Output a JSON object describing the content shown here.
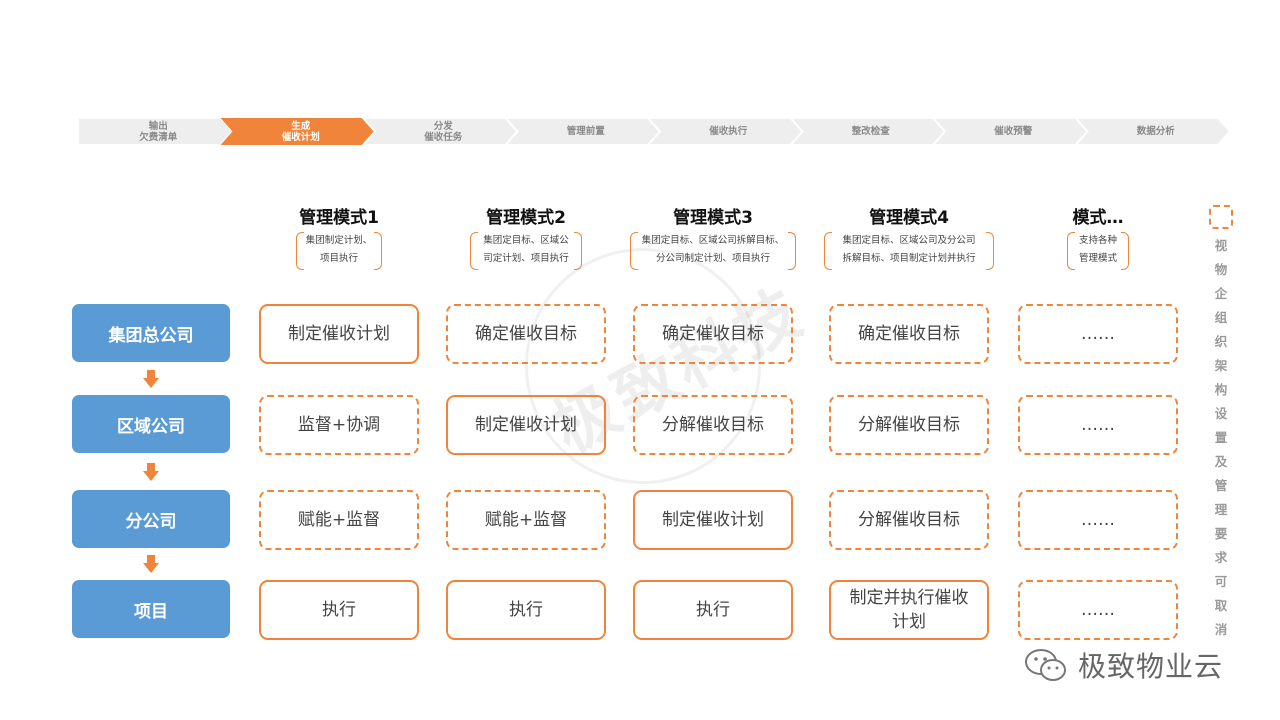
{
  "process": {
    "steps": [
      {
        "line1": "输出",
        "line2": "欠费清单",
        "active": false
      },
      {
        "line1": "生成",
        "line2": "催收计划",
        "active": true
      },
      {
        "line1": "分发",
        "line2": "催收任务",
        "active": false
      },
      {
        "line1": "管理前置",
        "line2": "",
        "active": false
      },
      {
        "line1": "催收执行",
        "line2": "",
        "active": false
      },
      {
        "line1": "整改检查",
        "line2": "",
        "active": false
      },
      {
        "line1": "催收预警",
        "line2": "",
        "active": false
      },
      {
        "line1": "数据分析",
        "line2": "",
        "active": false
      }
    ],
    "active_color": "#f0843a",
    "inactive_color": "#eeeeee"
  },
  "modes": [
    {
      "title": "管理模式1",
      "desc_line1": "集团制定计划、",
      "desc_line2": "项目执行"
    },
    {
      "title": "管理模式2",
      "desc_line1": "集团定目标、区域公",
      "desc_line2": "司定计划、项目执行"
    },
    {
      "title": "管理模式3",
      "desc_line1": "集团定目标、区域公司拆解目标、",
      "desc_line2": "分公司制定计划、项目执行"
    },
    {
      "title": "管理模式4",
      "desc_line1": "集团定目标、区域公司及分公司",
      "desc_line2": "拆解目标、项目制定计划并执行"
    },
    {
      "title": "模式…",
      "desc_line1": "支持各种",
      "desc_line2": "管理模式"
    }
  ],
  "levels": [
    "集团总公司",
    "区域公司",
    "分公司",
    "项目"
  ],
  "grid": [
    [
      "制定催收计划",
      "确定催收目标",
      "确定催收目标",
      "确定催收目标",
      "……"
    ],
    [
      "监督+协调",
      "制定催收计划",
      "分解催收目标",
      "分解催收目标",
      "……"
    ],
    [
      "赋能+监督",
      "赋能+监督",
      "制定催收计划",
      "分解催收目标",
      "……"
    ],
    [
      "执行",
      "执行",
      "执行",
      "制定并执行催收计划",
      "……"
    ]
  ],
  "note": "视物企组织架构设置及管理要求可取消",
  "watermark": "极致科技",
  "brand": "极致物业云",
  "colors": {
    "accent": "#f0843a",
    "level_blue": "#5b9bd5"
  }
}
